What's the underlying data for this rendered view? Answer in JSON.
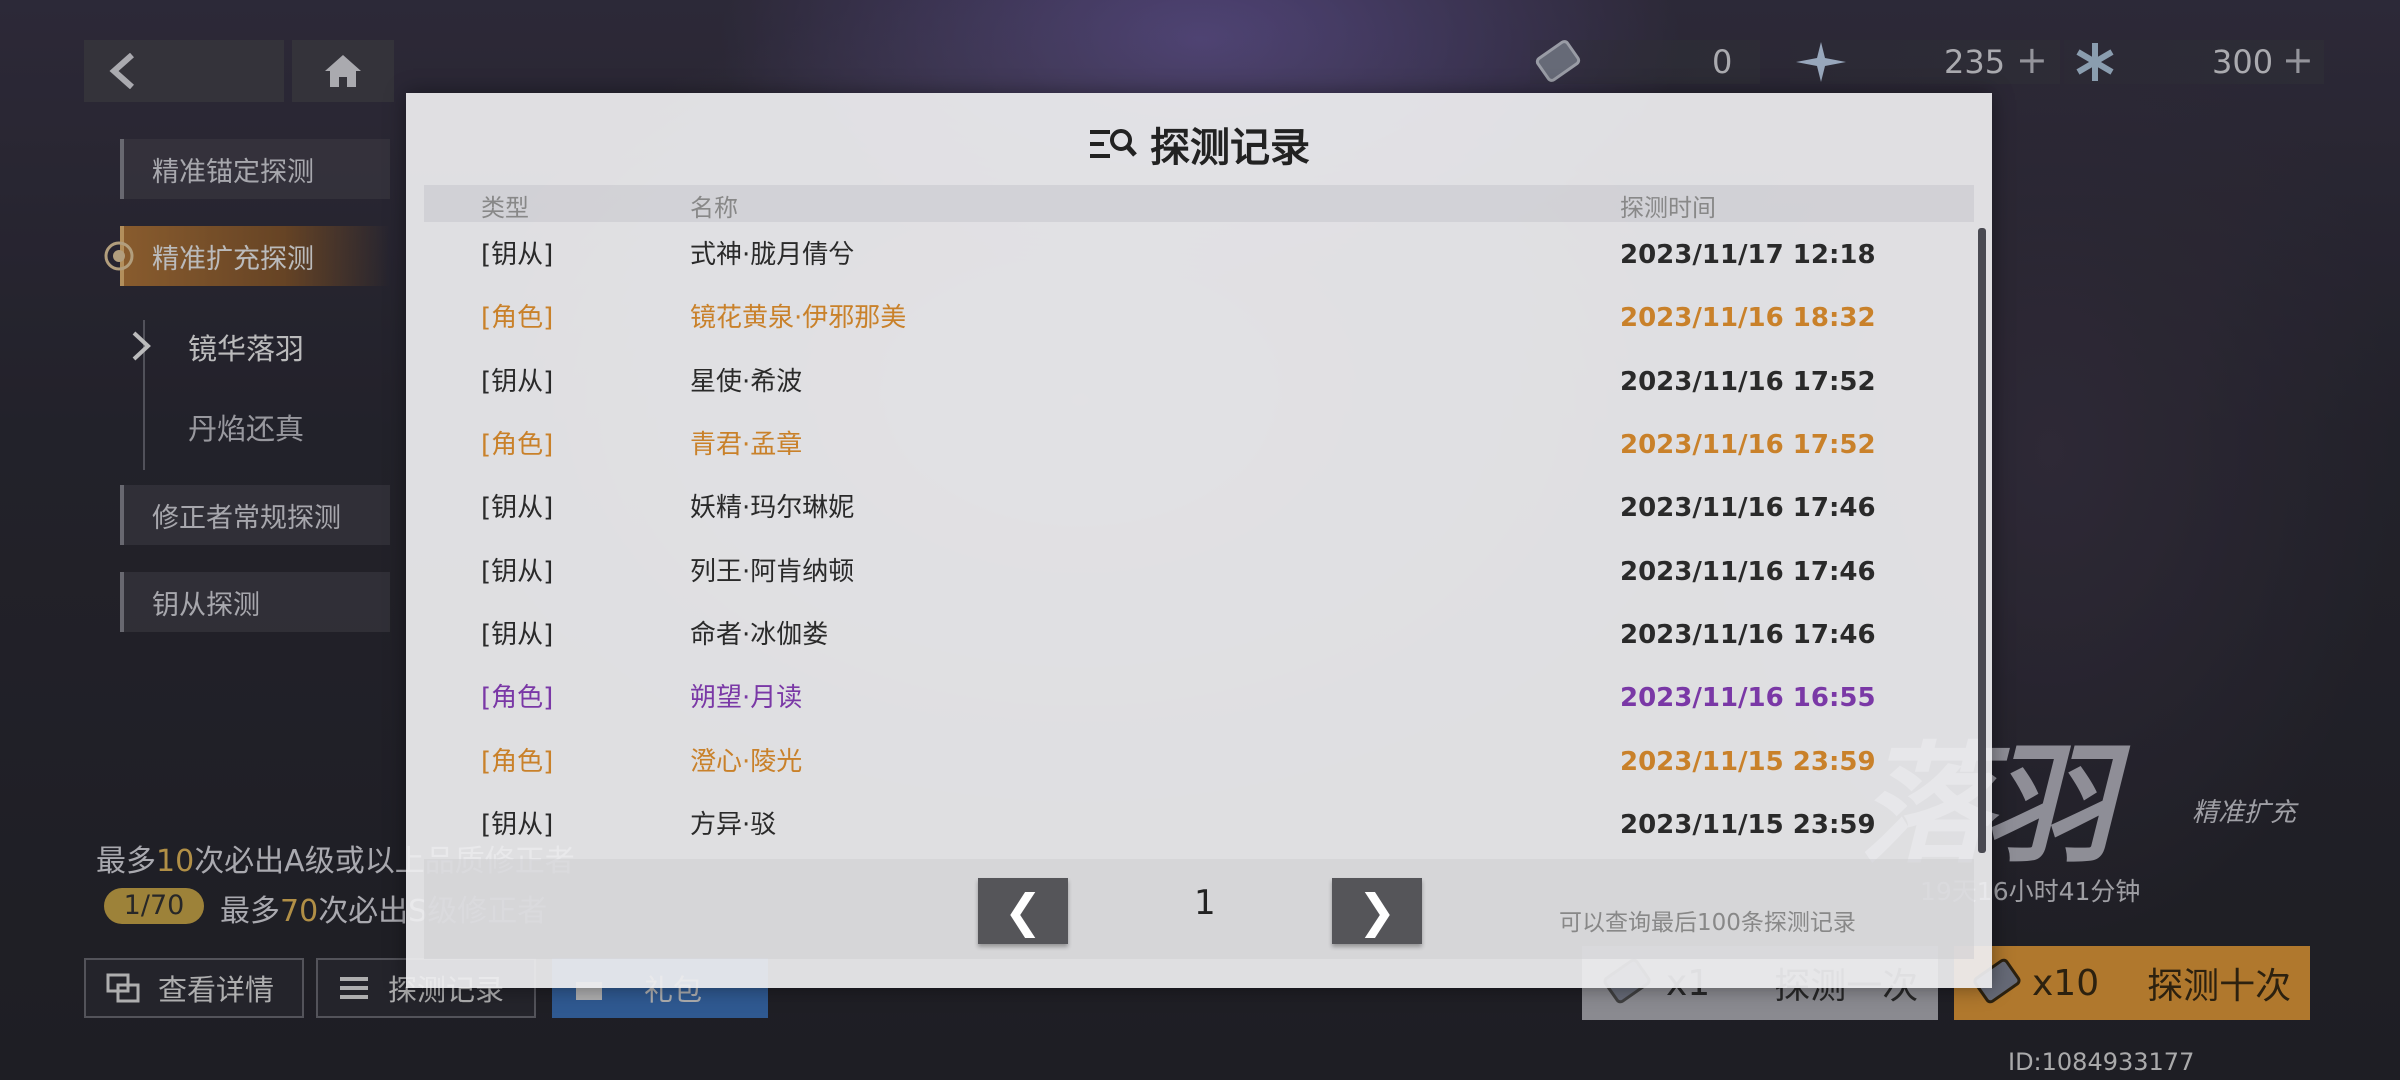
{
  "header": {
    "back_icon": "chevron-left-icon",
    "home_icon": "home-icon",
    "resources": [
      {
        "icon": "ticket-icon",
        "value": "0",
        "show_plus": false
      },
      {
        "icon": "star-crystal-icon",
        "value": "235",
        "show_plus": true
      },
      {
        "icon": "snowflake-crystal-icon",
        "value": "300",
        "show_plus": true
      }
    ],
    "plus_symbol": "+"
  },
  "sidebar": {
    "items": [
      {
        "label": "精准锚定探测"
      },
      {
        "label": "精准扩充探测"
      },
      {
        "label": "修正者常规探测"
      },
      {
        "label": "钥从探测"
      }
    ],
    "sub_items": [
      {
        "label": "镜华落羽"
      },
      {
        "label": "丹焰还真"
      }
    ]
  },
  "pity": {
    "line1_prefix": "最多",
    "line1_count": "10",
    "line1_suffix": "次必出A级或以上品质修正者",
    "progress": "1/70",
    "line2_prefix": "最多",
    "line2_count": "70",
    "line2_suffix": "次必出S级修正者"
  },
  "bottom_buttons": {
    "details": "查看详情",
    "records": "探测记录",
    "gift": "礼包"
  },
  "draw": {
    "single_count": "x1",
    "single_label": "探测一次",
    "ten_count": "x10",
    "ten_label": "探测十次"
  },
  "banner": {
    "title": "落羽",
    "subtitle": "精准扩充",
    "timer": "19天16小时41分钟"
  },
  "player_id": "ID:1084933177",
  "modal": {
    "title": "探测记录",
    "columns": {
      "type": "类型",
      "name": "名称",
      "time": "探测时间"
    },
    "rows": [
      {
        "type": "[钥从]",
        "name": "式神·胧月倩兮",
        "time": "2023/11/17 12:18",
        "color": "default"
      },
      {
        "type": "[角色]",
        "name": "镜花黄泉·伊邪那美",
        "time": "2023/11/16 18:32",
        "color": "orange"
      },
      {
        "type": "[钥从]",
        "name": "星使·希波",
        "time": "2023/11/16 17:52",
        "color": "default"
      },
      {
        "type": "[角色]",
        "name": "青君·孟章",
        "time": "2023/11/16 17:52",
        "color": "orange"
      },
      {
        "type": "[钥从]",
        "name": "妖精·玛尔琳妮",
        "time": "2023/11/16 17:46",
        "color": "default"
      },
      {
        "type": "[钥从]",
        "name": "列王·阿肯纳顿",
        "time": "2023/11/16 17:46",
        "color": "default"
      },
      {
        "type": "[钥从]",
        "name": "命者·冰伽娄",
        "time": "2023/11/16 17:46",
        "color": "default"
      },
      {
        "type": "[角色]",
        "name": "朔望·月读",
        "time": "2023/11/16 16:55",
        "color": "purple"
      },
      {
        "type": "[角色]",
        "name": "澄心·陵光",
        "time": "2023/11/15 23:59",
        "color": "orange"
      },
      {
        "type": "[钥从]",
        "name": "方异·驳",
        "time": "2023/11/15 23:59",
        "color": "default"
      }
    ],
    "page": "1",
    "prev_symbol": "❮",
    "next_symbol": "❯",
    "note": "可以查询最后100条探测记录"
  },
  "colors": {
    "orange": "#c9812a",
    "purple": "#7a38a6",
    "gold": "#f2c35c",
    "draw_ten_bg": "#f0a23a"
  }
}
